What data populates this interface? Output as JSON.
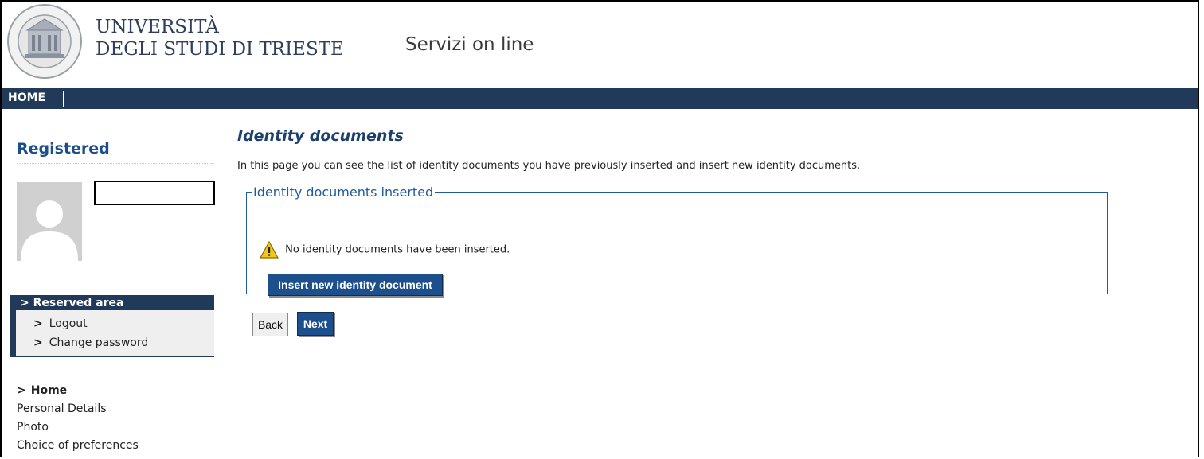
{
  "header": {
    "university_line1": "UNIVERSITÀ",
    "university_line2": "DEGLI STUDI DI TRIESTE",
    "service_name": "Servizi on line"
  },
  "navbar": {
    "home_label": "HOME"
  },
  "sidebar": {
    "title": "Registered",
    "reserved_area": {
      "heading": "Reserved area",
      "items": [
        "Logout",
        "Change password"
      ]
    },
    "menu": {
      "home": "Home",
      "items": [
        "Personal Details",
        "Photo",
        "Choice of preferences"
      ]
    }
  },
  "main": {
    "title": "Identity documents",
    "intro": "In this page you can see the list of identity documents you have previously inserted and insert new identity documents.",
    "docs_section": {
      "legend": "Identity documents inserted",
      "warning": "No identity documents have been inserted.",
      "insert_button": "Insert new identity document"
    },
    "back_button": "Back",
    "next_button": "Next"
  },
  "colors": {
    "navbar": "#213a5a",
    "accent_blue": "#1d4f8c",
    "title_blue": "#1c4e8c"
  }
}
